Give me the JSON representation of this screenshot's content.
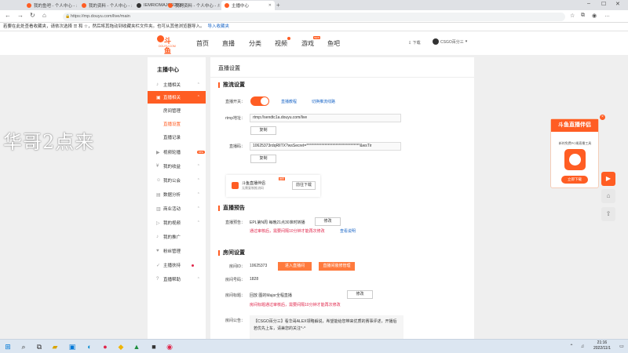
{
  "browser": {
    "tabs": [
      {
        "title": "我的鱼吧 - 个人中心 - 斗鱼",
        "active": false,
        "color": "#ff5d23"
      },
      {
        "title": "我的资料 - 个人中心 - 斗鱼",
        "active": false,
        "color": "#ff5d23"
      },
      {
        "title": "IEMRIOMAJOR2022",
        "active": false,
        "color": "#333333"
      },
      {
        "title": "我的资料 - 个人中心 - 斗鱼",
        "active": false,
        "color": "#ff5d23"
      },
      {
        "title": "主播中心",
        "active": true,
        "color": "#ff5d23"
      }
    ],
    "url": "https://mp.douyu.com/live/main",
    "bookmark_notice": "若要在此处查看收藏夹，请依次选择 ☰ 和 ☆，然后将其拖动到收藏夹栏文件夹。也可从其他浏览器导入。",
    "bookmark_import": "导入收藏夹"
  },
  "site": {
    "logo_text": "斗鱼",
    "logo_sub": "DOUYU.COM",
    "nav": [
      {
        "label": "首页"
      },
      {
        "label": "直播"
      },
      {
        "label": "分类"
      },
      {
        "label": "视频"
      },
      {
        "label": "游戏",
        "badge": "NEW"
      },
      {
        "label": "鱼吧"
      }
    ],
    "download": "下载",
    "username": "CSGO百分三"
  },
  "sidebar": {
    "title": "主播中心",
    "items": [
      {
        "label": "主播相关",
        "icon": "mic-icon"
      },
      {
        "label": "直播相关",
        "icon": "tv-icon",
        "active": true
      },
      {
        "label": "房间管理",
        "sub": true
      },
      {
        "label": "直播设置",
        "sub": true,
        "selected": true
      },
      {
        "label": "直播记录",
        "sub": true
      },
      {
        "label": "视频轮播",
        "icon": "video-icon",
        "badge": "new"
      },
      {
        "label": "我的收益",
        "icon": "wallet-icon"
      },
      {
        "label": "我的公会",
        "icon": "group-icon"
      },
      {
        "label": "数据分析",
        "icon": "chart-icon"
      },
      {
        "label": "商业活动",
        "icon": "briefcase-icon"
      },
      {
        "label": "我的视频",
        "icon": "play-icon"
      },
      {
        "label": "我的推广",
        "icon": "mic-icon"
      },
      {
        "label": "粉丝管理",
        "icon": "fan-icon"
      },
      {
        "label": "主播扶持",
        "icon": "thumb-icon"
      },
      {
        "label": "直播帮助",
        "icon": "help-icon"
      }
    ]
  },
  "main": {
    "page_title": "直播设置",
    "stream": {
      "section": "推流设置",
      "switch_label": "直播开关：",
      "switch_on": true,
      "link1": "直播教程",
      "link2": "切换推流线路",
      "rtmp_label": "rtmp地址：",
      "rtmp_value": "rtmp://sendtc1a.douyu.com/live",
      "copy": "复制",
      "code_label": "直播码：",
      "code_value": "10625373rdqRlITX?wsSecret=***********************************&wsTir",
      "companion_title": "斗鱼直播伴侣",
      "companion_sub": "无需复制推流码",
      "companion_badge": "推荐",
      "companion_btn": "前往下载"
    },
    "notice": {
      "section": "直播预告",
      "label": "直播预告：",
      "value": "EPL第N周 每晚21点30准时转播",
      "edit": "修改",
      "warn": "通过审核后，需要间隔10分钟才能再次修改",
      "history": "查看说明"
    },
    "room": {
      "section": "房间设置",
      "id_label": "房间ID：",
      "id_value": "10625373",
      "btn_enter": "进入直播间",
      "btn_manage": "直播间装修管理",
      "num_label": "房间号码：",
      "num_value": "1828",
      "title_label": "房间标题：",
      "title_value": "回放 图的Major全程直播",
      "title_edit": "修改",
      "title_warn": "房间标题通过审核后，需要间隔10分钟才能再次修改",
      "bulletin_label": "房间公告：",
      "bulletin_value": "【CSGO百分三】看华哥ALEX领略解说，希望能给您带来优质的赛事评述，开播后若优先上车，请兼您的关注^-^"
    }
  },
  "ad": {
    "title": "斗鱼直播伴侣",
    "desc": "新的免费PC端直播工具",
    "button": "立即下载"
  },
  "watermark": "华哥2点来",
  "clock": {
    "time": "21:16",
    "date": "2022/11/1"
  }
}
